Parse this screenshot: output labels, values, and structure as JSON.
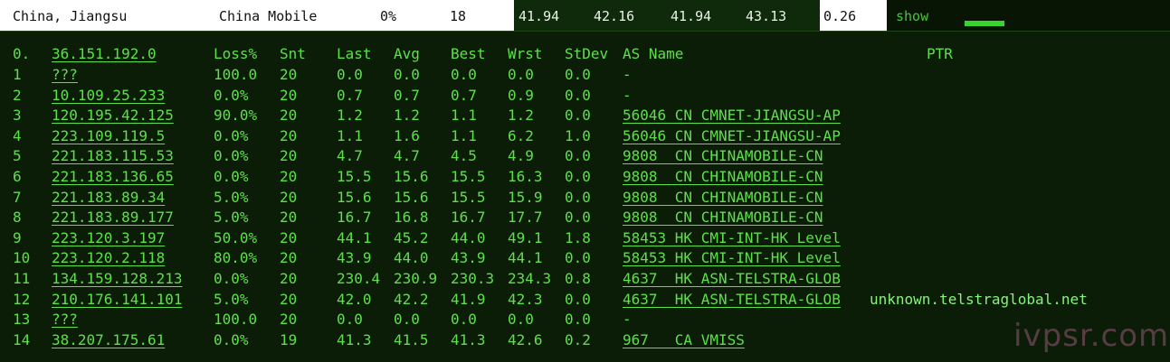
{
  "summary": {
    "location": "China, Jiangsu",
    "isp": "China Mobile",
    "loss": "0%",
    "sent": "18",
    "last": "41.94",
    "avg": "42.16",
    "best": "41.94",
    "worst": "43.13",
    "stdev": "0.26",
    "action": "show"
  },
  "trace": {
    "target_index": "0.",
    "target_host": "36.151.192.0",
    "columns": [
      "Loss%",
      "Snt",
      "Last",
      "Avg",
      "Best",
      "Wrst",
      "StDev",
      "AS Name",
      "PTR"
    ],
    "hops": [
      {
        "n": "1",
        "host": "???",
        "loss": "100.0",
        "snt": "20",
        "last": "0.0",
        "avg": "0.0",
        "best": "0.0",
        "wrst": "0.0",
        "stdev": "0.0",
        "as": "-",
        "ptr": ""
      },
      {
        "n": "2",
        "host": "10.109.25.233",
        "loss": "0.0%",
        "snt": "20",
        "last": "0.7",
        "avg": "0.7",
        "best": "0.7",
        "wrst": "0.9",
        "stdev": "0.0",
        "as": "-",
        "ptr": ""
      },
      {
        "n": "3",
        "host": "120.195.42.125",
        "loss": "90.0%",
        "snt": "20",
        "last": "1.2",
        "avg": "1.2",
        "best": "1.1",
        "wrst": "1.2",
        "stdev": "0.0",
        "as": "56046 CN CMNET-JIANGSU-AP",
        "ptr": ""
      },
      {
        "n": "4",
        "host": "223.109.119.5",
        "loss": "0.0%",
        "snt": "20",
        "last": "1.1",
        "avg": "1.6",
        "best": "1.1",
        "wrst": "6.2",
        "stdev": "1.0",
        "as": "56046 CN CMNET-JIANGSU-AP",
        "ptr": ""
      },
      {
        "n": "5",
        "host": "221.183.115.53",
        "loss": "0.0%",
        "snt": "20",
        "last": "4.7",
        "avg": "4.7",
        "best": "4.5",
        "wrst": "4.9",
        "stdev": "0.0",
        "as": "9808  CN CHINAMOBILE-CN",
        "ptr": ""
      },
      {
        "n": "6",
        "host": "221.183.136.65",
        "loss": "0.0%",
        "snt": "20",
        "last": "15.5",
        "avg": "15.6",
        "best": "15.5",
        "wrst": "16.3",
        "stdev": "0.0",
        "as": "9808  CN CHINAMOBILE-CN",
        "ptr": ""
      },
      {
        "n": "7",
        "host": "221.183.89.34",
        "loss": "5.0%",
        "snt": "20",
        "last": "15.6",
        "avg": "15.6",
        "best": "15.5",
        "wrst": "15.9",
        "stdev": "0.0",
        "as": "9808  CN CHINAMOBILE-CN",
        "ptr": ""
      },
      {
        "n": "8",
        "host": "221.183.89.177",
        "loss": "5.0%",
        "snt": "20",
        "last": "16.7",
        "avg": "16.8",
        "best": "16.7",
        "wrst": "17.7",
        "stdev": "0.0",
        "as": "9808  CN CHINAMOBILE-CN",
        "ptr": ""
      },
      {
        "n": "9",
        "host": "223.120.3.197",
        "loss": "50.0%",
        "snt": "20",
        "last": "44.1",
        "avg": "45.2",
        "best": "44.0",
        "wrst": "49.1",
        "stdev": "1.8",
        "as": "58453 HK CMI-INT-HK Level",
        "ptr": ""
      },
      {
        "n": "10",
        "host": "223.120.2.118",
        "loss": "80.0%",
        "snt": "20",
        "last": "43.9",
        "avg": "44.0",
        "best": "43.9",
        "wrst": "44.1",
        "stdev": "0.0",
        "as": "58453 HK CMI-INT-HK Level",
        "ptr": ""
      },
      {
        "n": "11",
        "host": "134.159.128.213",
        "loss": "0.0%",
        "snt": "20",
        "last": "230.4",
        "avg": "230.9",
        "best": "230.3",
        "wrst": "234.3",
        "stdev": "0.8",
        "as": "4637  HK ASN-TELSTRA-GLOB",
        "ptr": ""
      },
      {
        "n": "12",
        "host": "210.176.141.101",
        "loss": "5.0%",
        "snt": "20",
        "last": "42.0",
        "avg": "42.2",
        "best": "41.9",
        "wrst": "42.3",
        "stdev": "0.0",
        "as": "4637  HK ASN-TELSTRA-GLOB",
        "ptr": "unknown.telstraglobal.net"
      },
      {
        "n": "13",
        "host": "???",
        "loss": "100.0",
        "snt": "20",
        "last": "0.0",
        "avg": "0.0",
        "best": "0.0",
        "wrst": "0.0",
        "stdev": "0.0",
        "as": "-",
        "ptr": ""
      },
      {
        "n": "14",
        "host": "38.207.175.61",
        "loss": "0.0%",
        "snt": "19",
        "last": "41.3",
        "avg": "41.5",
        "best": "41.3",
        "wrst": "42.6",
        "stdev": "0.2",
        "as": "967   CA VMISS",
        "ptr": ""
      }
    ]
  },
  "watermark": "ivpsr.com",
  "colors": {
    "terminal_bg": "#0b1d07",
    "terminal_text": "#5ee04a",
    "summary_bar": "#ffffff"
  }
}
